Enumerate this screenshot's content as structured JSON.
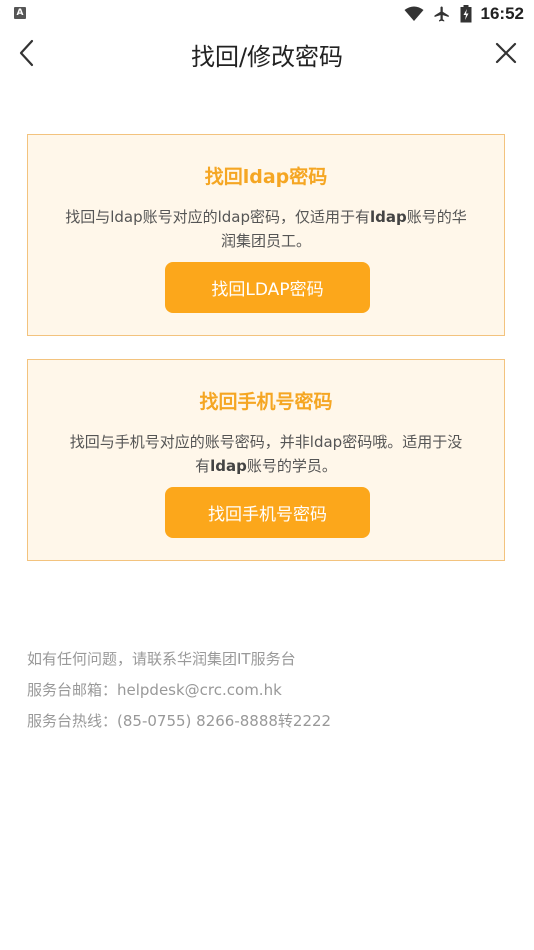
{
  "status_bar": {
    "app_icon_letter": "A",
    "time": "16:52"
  },
  "nav": {
    "title": "找回/修改密码"
  },
  "cards": [
    {
      "title": "找回ldap密码",
      "desc_part1": "找回与ldap账号对应的ldap密码，仅适用于有",
      "desc_bold": "ldap",
      "desc_part2": "账号的华润集团员工。",
      "button_label": "找回LDAP密码"
    },
    {
      "title": "找回手机号密码",
      "desc_part1": "找回与手机号对应的账号密码，并非ldap密码哦。适用于没有",
      "desc_bold": "ldap",
      "desc_part2": "账号的学员。",
      "button_label": "找回手机号密码"
    }
  ],
  "footer": {
    "help_text": "如有任何问题，请联系华润集团IT服务台",
    "email_line": "服务台邮箱：helpdesk@crc.com.hk",
    "hotline": "服务台热线：(85-0755) 8266-8888转2222"
  },
  "colors": {
    "accent": "#fca71b",
    "title_orange": "#f5a623",
    "card_bg": "#fff7ea",
    "card_border": "#f3c37e"
  }
}
